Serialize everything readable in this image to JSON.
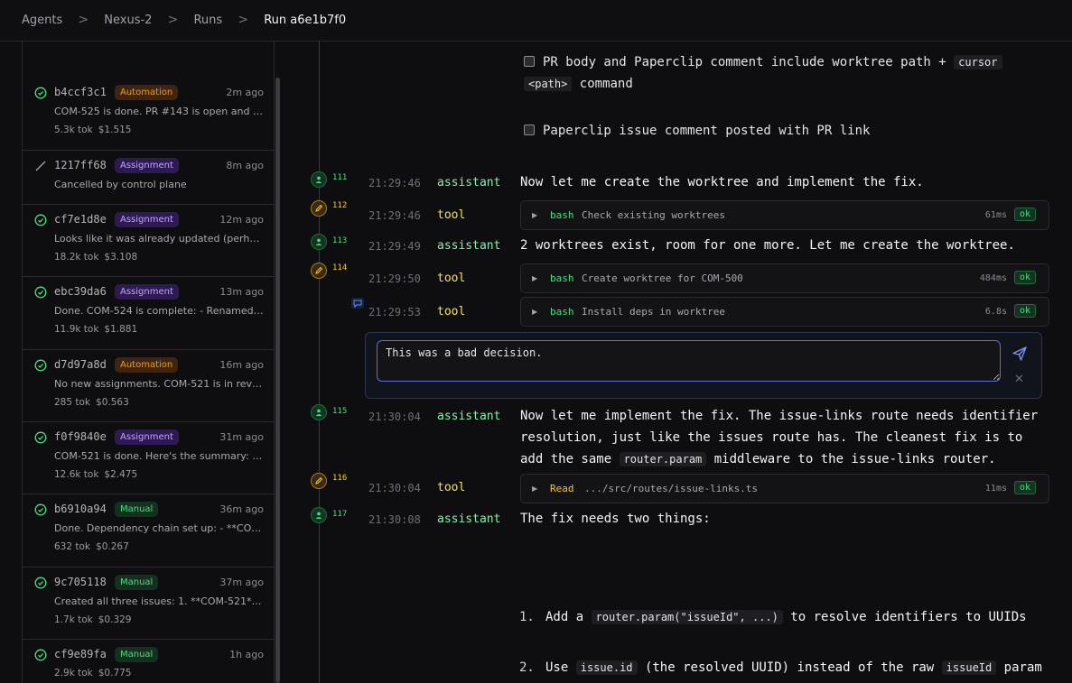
{
  "breadcrumb": {
    "items": [
      "Agents",
      "Nexus-2",
      "Runs",
      "Run a6e1b7f0"
    ],
    "separator": ">"
  },
  "runs": [
    {
      "id": "b4ccf3c1",
      "badge": "Automation",
      "badge_type": "automation",
      "time": "2m ago",
      "status": "success",
      "summary": "COM-525 is done. PR #143 is open and me...",
      "tokens": "5.3k tok",
      "cost": "$1.515"
    },
    {
      "id": "1217ff68",
      "badge": "Assignment",
      "badge_type": "assignment",
      "time": "8m ago",
      "status": "cancelled",
      "summary": "Cancelled by control plane",
      "tokens": "",
      "cost": ""
    },
    {
      "id": "cf7e1d8e",
      "badge": "Assignment",
      "badge_type": "assignment",
      "time": "12m ago",
      "status": "success",
      "summary": "Looks like it was already updated (perhap...",
      "tokens": "18.2k tok",
      "cost": "$3.108"
    },
    {
      "id": "ebc39da6",
      "badge": "Assignment",
      "badge_type": "assignment",
      "time": "13m ago",
      "status": "success",
      "summary": "Done. COM-524 is complete: - Renamed \"...",
      "tokens": "11.9k tok",
      "cost": "$1.881"
    },
    {
      "id": "d7d97a8d",
      "badge": "Automation",
      "badge_type": "automation",
      "time": "16m ago",
      "status": "success",
      "summary": "No new assignments. COM-521 is in revie...",
      "tokens": "285 tok",
      "cost": "$0.563"
    },
    {
      "id": "f0f9840e",
      "badge": "Assignment",
      "badge_type": "assignment",
      "time": "31m ago",
      "status": "success",
      "summary": "COM-521 is done. Here's the summary: **...",
      "tokens": "12.6k tok",
      "cost": "$2.475"
    },
    {
      "id": "b6910a94",
      "badge": "Manual",
      "badge_type": "manual",
      "time": "36m ago",
      "status": "success",
      "summary": "Done. Dependency chain set up: - **COM...",
      "tokens": "632 tok",
      "cost": "$0.267"
    },
    {
      "id": "9c705118",
      "badge": "Manual",
      "badge_type": "manual",
      "time": "37m ago",
      "status": "success",
      "summary": "Created all three issues: 1. **COM-521** ...",
      "tokens": "1.7k tok",
      "cost": "$0.329"
    },
    {
      "id": "cf9e89fa",
      "badge": "Manual",
      "badge_type": "manual",
      "time": "1h ago",
      "status": "success",
      "summary": "",
      "tokens": "2.9k tok",
      "cost": "$0.775"
    }
  ],
  "checklist": [
    {
      "pre": "PR body and Paperclip comment include worktree path + ",
      "code1": "cursor",
      "code2": "<path>",
      "post": " command"
    },
    {
      "text": "Paperclip issue comment posted with PR link"
    }
  ],
  "events": [
    {
      "seq": "111",
      "kind": "assistant",
      "time": "21:29:46",
      "role": "assistant",
      "text": "Now let me create the worktree and implement the fix."
    },
    {
      "seq": "112",
      "kind": "tool",
      "time": "21:29:46",
      "role": "tool",
      "tool": "bash",
      "desc": "Check existing worktrees",
      "duration": "61ms",
      "status": "ok"
    },
    {
      "seq": "113",
      "kind": "assistant",
      "time": "21:29:49",
      "role": "assistant",
      "text": "2 worktrees exist, room for one more. Let me create the worktree."
    },
    {
      "seq": "114",
      "kind": "tool",
      "time": "21:29:50",
      "role": "tool",
      "tool": "bash",
      "desc": "Create worktree for COM-500",
      "duration": "484ms",
      "status": "ok"
    },
    {
      "seq": "",
      "kind": "tool",
      "time": "21:29:53",
      "role": "tool",
      "tool": "bash",
      "desc": "Install deps in worktree",
      "duration": "6.8s",
      "status": "ok"
    },
    {
      "seq": "115",
      "kind": "assistant",
      "time": "21:30:04",
      "role": "assistant",
      "line1": "Now let me implement the fix. The issue-links route needs identifier",
      "line2": "resolution, just like the issues route has. The cleanest fix is to",
      "line3_pre": "add the same ",
      "line3_code": "router.param",
      "line3_post": " middleware to the issue-links router."
    },
    {
      "seq": "116",
      "kind": "tool",
      "time": "21:30:04",
      "role": "tool",
      "tool": "Read",
      "desc": ".../src/routes/issue-links.ts",
      "duration": "11ms",
      "status": "ok"
    },
    {
      "seq": "117",
      "kind": "assistant",
      "time": "21:30:08",
      "role": "assistant",
      "text": "The fix needs two things:"
    }
  ],
  "composer": {
    "value": "This was a bad decision. "
  },
  "fix_list": [
    {
      "num": "1.",
      "pre": "Add a ",
      "code": "router.param(\"issueId\", ...)",
      "post": " to resolve identifiers to UUIDs"
    },
    {
      "num": "2.",
      "pre": "Use ",
      "code": "issue.id",
      "mid": " (the resolved UUID) instead of the raw ",
      "code2": "issueId",
      "post": " param"
    }
  ],
  "colors": {
    "accent": "#5b6ed6",
    "assistant": "#86efac",
    "tool": "#fde047",
    "ok": "#4ade80"
  }
}
